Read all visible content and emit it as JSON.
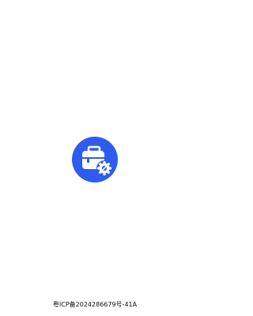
{
  "splash": {
    "logo_icon": "toolbox-gear-icon",
    "logo_color": "#2f5cf0",
    "background_color": "#ffffff"
  },
  "footer": {
    "icp_text": "粤ICP备2024286679号-41A"
  }
}
